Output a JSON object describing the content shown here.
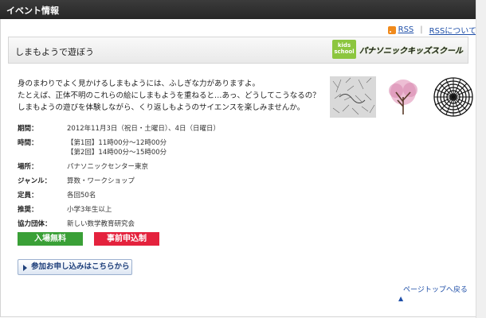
{
  "header": {
    "title": "イベント情報"
  },
  "rss": {
    "link1": "RSS",
    "link2": "RSSについて"
  },
  "page": {
    "title": "しまもようで遊ぼう",
    "logo_badge": "kids school",
    "logo_name": "パナソニックキッズスクール"
  },
  "description": [
    "身のまわりでよく見かけるしまもようには、ふしぎな力がありますよ。",
    "たとえば、正体不明のこれらの絵にしまもようを重ねると…あっ、どうしてこうなるの？",
    "しまもようの遊びを体験しながら、くり返しもようのサイエンスを楽しみませんか。"
  ],
  "info": {
    "period": {
      "label": "期間：",
      "value": "2012年11月3日（祝日・土曜日）、4日（日曜日）"
    },
    "time": {
      "label": "時間：",
      "value1": "【第1回】11時00分～12時00分",
      "value2": "【第2回】14時00分～15時00分"
    },
    "venue": {
      "label": "場所：",
      "value": "パナソニックセンター東京"
    },
    "genre": {
      "label": "ジャンル：",
      "value": "算数・ワークショップ"
    },
    "capacity": {
      "label": "定員：",
      "value": "各回50名"
    },
    "recommend": {
      "label": "推奨：",
      "value": "小学3年生以上"
    },
    "cooperation": {
      "label": "協力団体：",
      "value": "新しい数学教育研究会"
    }
  },
  "badges": {
    "free": "入場無料",
    "advance": "事前申込制"
  },
  "apply_button": "参加お申し込みはこちらから",
  "pagetop": "ページトップへ戻る",
  "colors": {
    "header": "#2f2f2f",
    "badge_green": "#3aa037",
    "badge_red": "#e4223d",
    "link": "#1f4fa8"
  }
}
